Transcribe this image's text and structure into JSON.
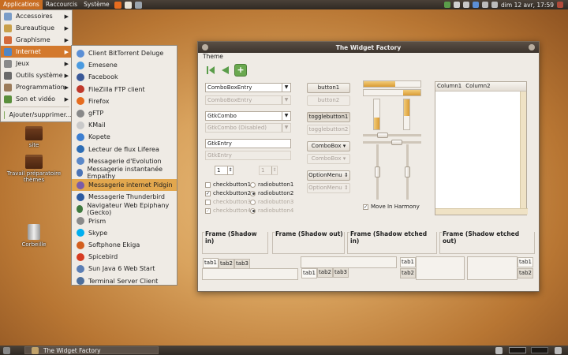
{
  "top_panel": {
    "menus": [
      "Applications",
      "Raccourcis",
      "Système"
    ],
    "clock": "dim 12 avr, 17:59"
  },
  "apps_menu": {
    "items": [
      {
        "label": "Accessoires",
        "icon": "accessories-icon",
        "color": "#7a9dc8"
      },
      {
        "label": "Bureautique",
        "icon": "office-icon",
        "color": "#c9a04a"
      },
      {
        "label": "Graphisme",
        "icon": "graphics-icon",
        "color": "#d46a3a"
      },
      {
        "label": "Internet",
        "icon": "internet-icon",
        "color": "#4f86c6"
      },
      {
        "label": "Jeux",
        "icon": "games-icon",
        "color": "#8a8a8a"
      },
      {
        "label": "Outils système",
        "icon": "system-tools-icon",
        "color": "#6a6a6a"
      },
      {
        "label": "Programmation",
        "icon": "programming-icon",
        "color": "#9b7c5b"
      },
      {
        "label": "Son et vidéo",
        "icon": "sound-video-icon",
        "color": "#5a8f3c"
      }
    ],
    "add_label": "Ajouter/supprimer..."
  },
  "sub_menu": {
    "items": [
      {
        "label": "Client BitTorrent Deluge",
        "icon": "deluge-icon",
        "color": "#5b8fd6"
      },
      {
        "label": "Emesene",
        "icon": "emesene-icon",
        "color": "#4a9ae0"
      },
      {
        "label": "Facebook",
        "icon": "facebook-icon",
        "color": "#3b5998"
      },
      {
        "label": "FileZilla FTP client",
        "icon": "filezilla-icon",
        "color": "#c0392b"
      },
      {
        "label": "Firefox",
        "icon": "firefox-icon",
        "color": "#e66c1f"
      },
      {
        "label": "gFTP",
        "icon": "gftp-icon",
        "color": "#888888"
      },
      {
        "label": "KMail",
        "icon": "kmail-icon",
        "color": "#c9c9c9"
      },
      {
        "label": "Kopete",
        "icon": "kopete-icon",
        "color": "#3d7fd1"
      },
      {
        "label": "Lecteur de flux Liferea",
        "icon": "liferea-icon",
        "color": "#2d6db5"
      },
      {
        "label": "Messagerie d'Evolution",
        "icon": "evolution-icon",
        "color": "#5a88c9"
      },
      {
        "label": "Messagerie instantanée Empathy",
        "icon": "empathy-icon",
        "color": "#4a74b8"
      },
      {
        "label": "Messagerie internet Pidgin",
        "icon": "pidgin-icon",
        "color": "#7a5ca8"
      },
      {
        "label": "Messagerie Thunderbird",
        "icon": "thunderbird-icon",
        "color": "#2c5aa0"
      },
      {
        "label": "Navigateur Web Epiphany (Gecko)",
        "icon": "epiphany-icon",
        "color": "#3e7a3e"
      },
      {
        "label": "Prism",
        "icon": "prism-icon",
        "color": "#8a8a8a"
      },
      {
        "label": "Skype",
        "icon": "skype-icon",
        "color": "#00aff0"
      },
      {
        "label": "Softphone Ekiga",
        "icon": "ekiga-icon",
        "color": "#d35f1e"
      },
      {
        "label": "Spicebird",
        "icon": "spicebird-icon",
        "color": "#d63b22"
      },
      {
        "label": "Sun Java 6 Web Start",
        "icon": "java-icon",
        "color": "#5c7fb5"
      },
      {
        "label": "Terminal Server Client",
        "icon": "tsclient-icon",
        "color": "#4d6f9c"
      }
    ],
    "highlighted_index": 11
  },
  "desktop": {
    "icons": [
      {
        "label": "site",
        "icon": "folder-icon"
      },
      {
        "label": "Travail préparatoire thèmes",
        "icon": "folder-icon"
      },
      {
        "label": "Corbeille",
        "icon": "trash-icon"
      }
    ]
  },
  "window": {
    "title": "The Widget Factory",
    "menu": "Theme",
    "combos": {
      "entry": "ComboBoxEntry",
      "entry_disabled": "ComboBoxEntry",
      "gtkcombo": "GtkCombo",
      "gtkcombo_disabled": "GtkCombo (Disabled)",
      "gtkentry": "GtkEntry",
      "gtkentry_disabled": "GtkEntry"
    },
    "spin": {
      "value": "1",
      "disabled_value": "1"
    },
    "checks": {
      "check1": "checkbutton1",
      "check2": "checkbutton2",
      "check3": "checkbutton3",
      "check4": "checkbutton4",
      "radio1": "radiobutton1",
      "radio2": "radiobutton2",
      "radio3": "radiobutton3",
      "radio4": "radiobutton4"
    },
    "buttons": {
      "button1": "button1",
      "button2": "button2",
      "toggle1": "togglebutton1",
      "toggle2": "togglebutton2",
      "combobox": "ComboBox",
      "combobox_disabled": "ComboBox",
      "optionmenu": "OptionMenu",
      "optionmenu_disabled": "OptionMenu"
    },
    "progress": {
      "h1": 0.55,
      "h2": 0.3,
      "v1": 0.4,
      "v2": 0.55
    },
    "move_harmony": "Move In Harmony",
    "tree_columns": [
      "Column1",
      "Column2"
    ],
    "frames": [
      "Frame (Shadow in)",
      "Frame (Shadow out)",
      "Frame (Shadow etched in)",
      "Frame (Shadow etched out)"
    ],
    "tabs": [
      "tab1",
      "tab2",
      "tab3"
    ]
  },
  "taskbar": {
    "task": "The Widget Factory"
  }
}
